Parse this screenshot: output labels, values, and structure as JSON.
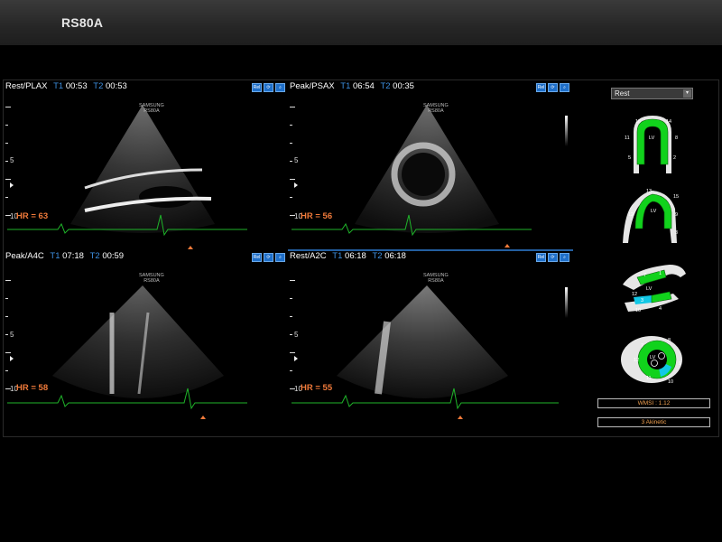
{
  "app": {
    "title": "RS80A"
  },
  "panels": [
    {
      "view": "Rest/PLAX",
      "t1_label": "T1",
      "t1_value": "00:53",
      "t2_label": "T2",
      "t2_value": "00:53",
      "hr": "HR = 63"
    },
    {
      "view": "Peak/PSAX",
      "t1_label": "T1",
      "t1_value": "06:54",
      "t2_label": "T2",
      "t2_value": "00:35",
      "hr": "HR = 56"
    },
    {
      "view": "Peak/A4C",
      "t1_label": "T1",
      "t1_value": "07:18",
      "t2_label": "T2",
      "t2_value": "00:59",
      "hr": "HR = 58"
    },
    {
      "view": "Rest/A2C",
      "t1_label": "T1",
      "t1_value": "06:18",
      "t2_label": "T2",
      "t2_value": "06:18",
      "hr": "HR = 55"
    }
  ],
  "depth_labels": {
    "mid": "5",
    "deep": "10"
  },
  "probe_logo": {
    "line1": "SAMSUNG",
    "line2": "RS80A"
  },
  "panel_icons": [
    "Rel",
    "rotate-icon",
    "zoom-icon"
  ],
  "stage_select": {
    "value": "Rest"
  },
  "segment_labels": {
    "a4c": [
      "16",
      "14",
      "11",
      "8",
      "5",
      "2"
    ],
    "a2c": [
      "13",
      "15",
      "12",
      "9",
      "3"
    ],
    "plax": [
      "7",
      "1",
      "12",
      "3",
      "10",
      "4"
    ],
    "sax": [
      "7",
      "8",
      "12",
      "11",
      "9",
      "10"
    ],
    "lv": "LV"
  },
  "wmsi": "WMSI : 1.12",
  "akinetic": "3 Akinetic",
  "colors": {
    "ecg": "#1fb52a",
    "hr": "#f07a3a",
    "time_label": "#3d8fe0",
    "normal_segment": "#11d21c",
    "akinetic_segment": "#12c8e6",
    "summary_text": "#f0a050"
  }
}
